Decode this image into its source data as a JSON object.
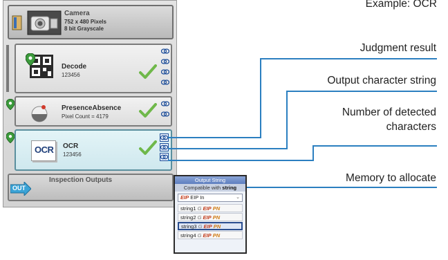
{
  "example_label": "Example: OCR",
  "panel": {
    "camera": {
      "title": "Camera",
      "line1": "752 x 480 Pixels",
      "line2": "8 bit Grayscale"
    },
    "tools": [
      {
        "name": "Decode",
        "value": "123456"
      },
      {
        "name": "PresenceAbsence",
        "value": "Pixel Count = 4179"
      },
      {
        "name": "OCR",
        "value": "123456",
        "icon_text": "OCR"
      }
    ],
    "outputs": {
      "title": "Inspection Outputs",
      "icon_text": "OUT"
    }
  },
  "popup": {
    "header": "Output String",
    "compatible_prefix": "Compatible with",
    "compatible_type": "string",
    "select": {
      "tag": "EIP",
      "value": "EIP In"
    },
    "rows": [
      {
        "label": "string1"
      },
      {
        "label": "string2"
      },
      {
        "label": "string3",
        "selected": true
      },
      {
        "label": "string4"
      }
    ],
    "tag_g": "G",
    "tag_eip": "EIP",
    "tag_pn": "PN"
  },
  "callouts": {
    "judgment": "Judgment result",
    "output_string": "Output character string",
    "detected_line1": "Number of detected",
    "detected_line2": "characters",
    "memory": "Memory to allocate"
  },
  "colors": {
    "accent": "#2b7fc0",
    "check": "#6fb84a",
    "link": "#1f4f9a"
  }
}
